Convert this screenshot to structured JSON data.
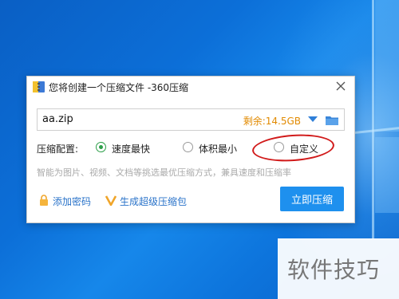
{
  "dialog": {
    "title": "您将创建一个压缩文件 -360压缩",
    "path_value": "aa.zip",
    "free_space": "剩余:14.5GB",
    "options_label": "压缩配置:",
    "options": [
      {
        "label": "速度最快",
        "selected": true
      },
      {
        "label": "体积最小",
        "selected": false
      },
      {
        "label": "自定义",
        "selected": false
      }
    ],
    "description": "智能为图片、视频、文档等挑选最优压缩方式，兼具速度和压缩率",
    "add_password_label": "添加密码",
    "super_archive_label": "生成超级压缩包",
    "compress_button_label": "立即压缩"
  },
  "watermark": {
    "text": "软件技巧"
  },
  "icons": {
    "app": "archive-icon",
    "close": "close-icon",
    "dropdown": "triangle-down-icon",
    "folder": "folder-icon",
    "password": "lock-icon",
    "super_archive": "v-check-icon"
  },
  "colors": {
    "accent": "#1e90ee",
    "free_space": "#e28a00",
    "radio_selected": "#2e9f4a",
    "highlight_circle": "#d11a1a",
    "link": "#2a73c9"
  }
}
